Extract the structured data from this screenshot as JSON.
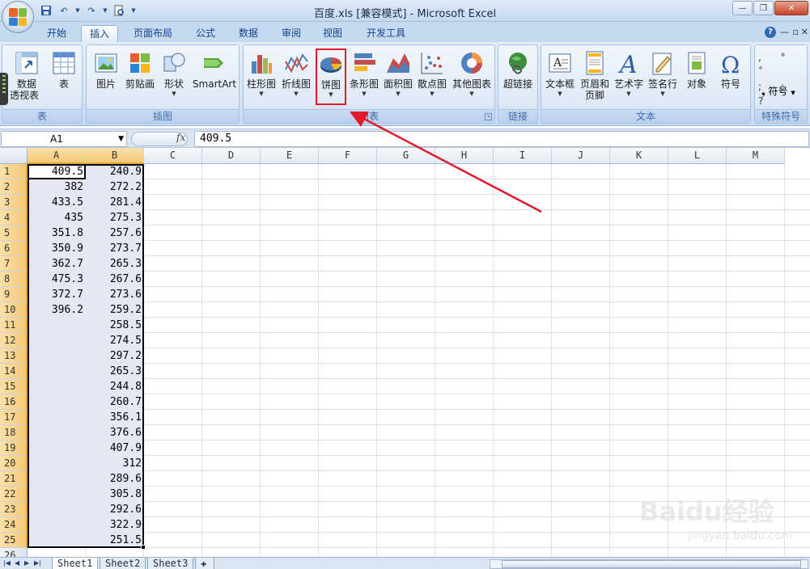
{
  "window": {
    "title": "百度.xls  [兼容模式] - Microsoft Excel"
  },
  "tabs": [
    {
      "label": "开始"
    },
    {
      "label": "插入"
    },
    {
      "label": "页面布局"
    },
    {
      "label": "公式"
    },
    {
      "label": "数据"
    },
    {
      "label": "审阅"
    },
    {
      "label": "视图"
    },
    {
      "label": "开发工具"
    }
  ],
  "ribbon": {
    "table_group": {
      "label": "表",
      "pivot_line1": "数据",
      "pivot_line2": "透视表",
      "table": "表"
    },
    "illustrations_group": {
      "label": "插图",
      "picture": "图片",
      "clipart": "剪贴画",
      "shapes": "形状",
      "smartart": "SmartArt"
    },
    "charts_group": {
      "label": "图表",
      "column": "柱形图",
      "line": "折线图",
      "pie": "饼图",
      "bar": "条形图",
      "area": "面积图",
      "scatter": "散点图",
      "other": "其他图表"
    },
    "links_group": {
      "label": "链接",
      "hyperlink": "超链接"
    },
    "text_group": {
      "label": "文本",
      "textbox": "文本框",
      "header_footer_line1": "页眉和",
      "header_footer_line2": "页脚",
      "wordart": "艺术字",
      "signature": "签名行",
      "object": "对象",
      "symbol": "符号"
    },
    "special_group": {
      "label": "特殊符号",
      "symbol": "符号"
    }
  },
  "formula_bar": {
    "name_box": "A1",
    "fx": "fx",
    "value": "409.5"
  },
  "columns": [
    "A",
    "B",
    "C",
    "D",
    "E",
    "F",
    "G",
    "H",
    "I",
    "J",
    "K",
    "L",
    "M"
  ],
  "rows": [
    "1",
    "2",
    "3",
    "4",
    "5",
    "6",
    "7",
    "8",
    "9",
    "10",
    "11",
    "12",
    "13",
    "14",
    "15",
    "16",
    "17",
    "18",
    "19",
    "20",
    "21",
    "22",
    "23",
    "24",
    "25",
    "26"
  ],
  "col_a": [
    "409.5",
    "382",
    "433.5",
    "435",
    "351.8",
    "350.9",
    "362.7",
    "475.3",
    "372.7",
    "396.2"
  ],
  "col_b": [
    "240.9",
    "272.2",
    "281.4",
    "275.3",
    "257.6",
    "273.7",
    "265.3",
    "267.6",
    "273.6",
    "259.2",
    "258.5",
    "274.5",
    "297.2",
    "265.3",
    "244.8",
    "260.7",
    "356.1",
    "376.6",
    "407.9",
    "312",
    "289.6",
    "305.8",
    "292.6",
    "322.9",
    "251.5"
  ],
  "sheets": [
    "Sheet1",
    "Sheet2",
    "Sheet3"
  ],
  "active_sheet": "Sheet1",
  "watermark": {
    "brand": "Baidu经验",
    "url": "jingyan.baidu.com"
  },
  "colors": {
    "highlight": "#e0192b",
    "arrow": "#e0192b",
    "selection_header": "#f5c977",
    "ribbon_blue": "#15428b"
  }
}
